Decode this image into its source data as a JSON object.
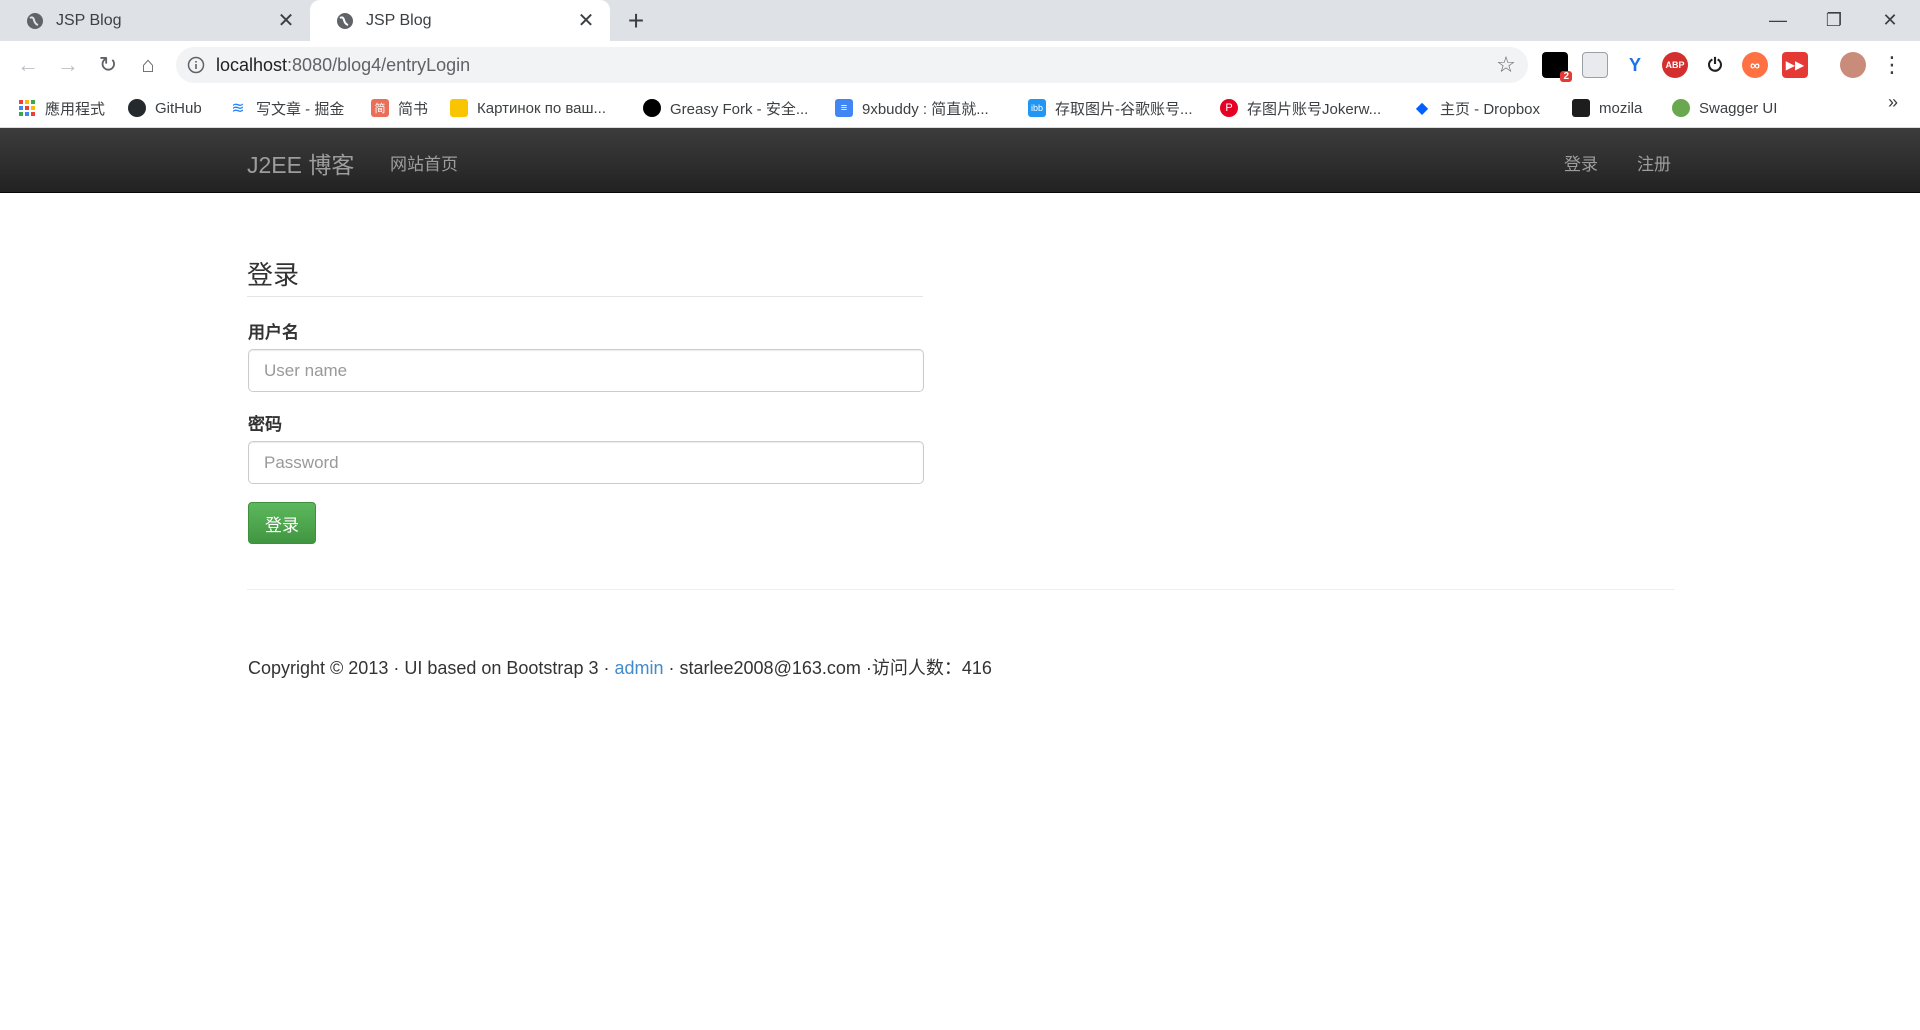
{
  "browser": {
    "tabs": [
      {
        "title": "JSP Blog",
        "favicon": "globe-icon",
        "active": false
      },
      {
        "title": "JSP Blog",
        "favicon": "globe-icon",
        "active": true
      }
    ],
    "url_host": "localhost",
    "url_path": ":8080/blog4/entryLogin",
    "extensions": [
      "notification-badge-icon",
      "image-icon",
      "v-icon",
      "adblock-icon",
      "power-icon",
      "infinity-icon",
      "video-icon"
    ],
    "extension_badge": "2",
    "bookmarks": [
      {
        "label": "應用程式",
        "icon": "apps-grid-icon"
      },
      {
        "label": "GitHub",
        "icon": "github-icon"
      },
      {
        "label": "写文章 - 掘金",
        "icon": "juejin-icon"
      },
      {
        "label": "简书",
        "icon": "jianshu-icon"
      },
      {
        "label": "Картинок по ваш...",
        "icon": "picture-icon"
      },
      {
        "label": "Greasy Fork - 安全...",
        "icon": "greasyfork-icon"
      },
      {
        "label": "9xbuddy : 简直就...",
        "icon": "document-icon"
      },
      {
        "label": "存取图片-谷歌账号...",
        "icon": "ibb-icon"
      },
      {
        "label": "存图片账号Jokerw...",
        "icon": "pinterest-icon"
      },
      {
        "label": "主页 - Dropbox",
        "icon": "dropbox-icon"
      },
      {
        "label": "mozila",
        "icon": "mdn-icon"
      },
      {
        "label": "Swagger UI",
        "icon": "swagger-icon"
      }
    ],
    "bookmarks_more": "»"
  },
  "navbar": {
    "brand": "J2EE 博客",
    "home": "网站首页",
    "login": "登录",
    "register": "注册"
  },
  "form": {
    "legend": "登录",
    "username_label": "用户名",
    "username_placeholder": "User name",
    "password_label": "密码",
    "password_placeholder": "Password",
    "submit_label": "登录",
    "submit_color": "#5cb85c"
  },
  "footer": {
    "copyright": "Copyright © 2013 · UI based on Bootstrap 3 · ",
    "admin_link": "admin",
    "contact": " · starlee2008@163.com ·访问人数：416"
  },
  "colors": {
    "navbar_bg": "#222222",
    "link": "#428bca"
  }
}
